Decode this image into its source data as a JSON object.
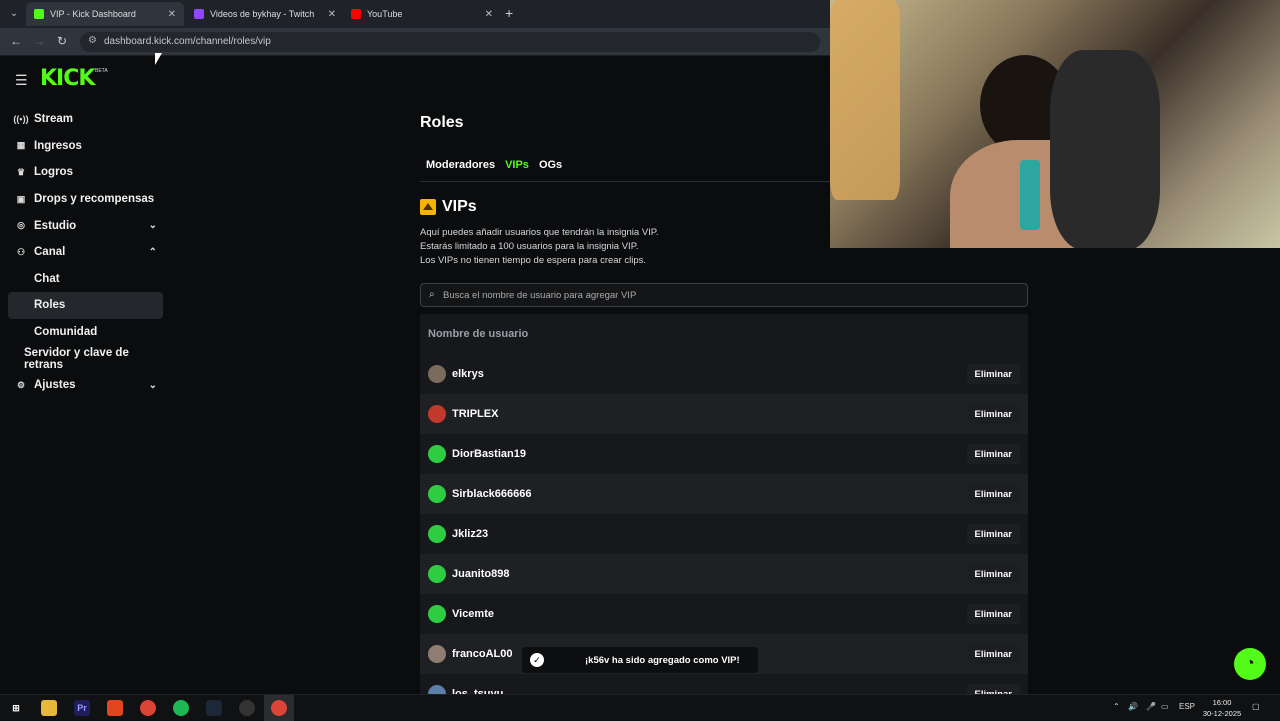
{
  "browser": {
    "tabs": [
      {
        "label": "VIP - Kick Dashboard",
        "favicon_color": "#53fc18",
        "active": true
      },
      {
        "label": "Videos de bykhay - Twitch",
        "favicon_color": "#9146ff",
        "active": false
      },
      {
        "label": "YouTube",
        "favicon_color": "#ff0000",
        "active": false
      }
    ],
    "url": "dashboard.kick.com/channel/roles/vip"
  },
  "brand": {
    "logo": "KICK",
    "badge": "BETA",
    "accent": "#53fc18"
  },
  "sidebar": {
    "items": [
      {
        "label": "Stream",
        "icon": "stream-icon"
      },
      {
        "label": "Ingresos",
        "icon": "chart-icon"
      },
      {
        "label": "Logros",
        "icon": "trophy-icon"
      },
      {
        "label": "Drops y recompensas",
        "icon": "gift-icon"
      },
      {
        "label": "Estudio",
        "icon": "studio-icon"
      },
      {
        "label": "Canal",
        "icon": "users-icon"
      },
      {
        "label": "Chat"
      },
      {
        "label": "Roles"
      },
      {
        "label": "Comunidad"
      },
      {
        "label": "Servidor y clave de retrans"
      },
      {
        "label": "Ajustes",
        "icon": "gear-icon"
      }
    ]
  },
  "main": {
    "title": "Roles",
    "tabs": [
      {
        "label": "Moderadores"
      },
      {
        "label": "VIPs"
      },
      {
        "label": "OGs"
      }
    ],
    "section_title": "VIPs",
    "description": [
      "Aquí puedes añadir usuarios que tendrán la insignia VIP.",
      "Estarás limitado a 100 usuarios para la insignia VIP.",
      "Los VIPs no tienen tiempo de espera para crear clips."
    ],
    "search_placeholder": "Busca el nombre de usuario para agregar VIP",
    "column_header": "Nombre de usuario",
    "remove_label": "Eliminar",
    "users": [
      {
        "name": "elkrys",
        "avatar_color": "#7a6b5d"
      },
      {
        "name": "TRIPLEX",
        "avatar_color": "#c0392b"
      },
      {
        "name": "DiorBastian19",
        "avatar_color": "#2ecc40"
      },
      {
        "name": "Sirblack666666",
        "avatar_color": "#2ecc40"
      },
      {
        "name": "Jkliz23",
        "avatar_color": "#2ecc40"
      },
      {
        "name": "Juanito898",
        "avatar_color": "#2ecc40"
      },
      {
        "name": "Vicemte",
        "avatar_color": "#2ecc40"
      },
      {
        "name": "francoAL00",
        "avatar_color": "#8e7d70"
      },
      {
        "name": "los_tsuyu",
        "avatar_color": "#5b7fa8"
      }
    ],
    "toast": "¡k56v ha sido agregado como VIP!"
  },
  "taskbar": {
    "tray": {
      "language": "ESP"
    },
    "clock": {
      "time": "16:00",
      "date": "30-12-2025"
    }
  }
}
